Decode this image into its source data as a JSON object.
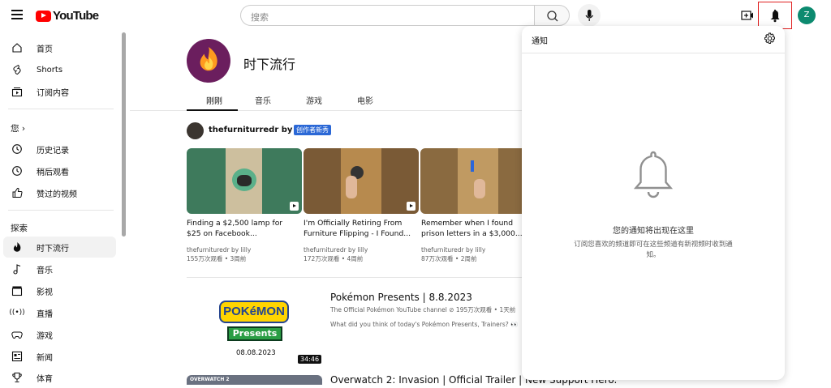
{
  "header": {
    "logo_text": "YouTube",
    "search_placeholder": "搜索",
    "avatar_letter": "Z"
  },
  "sidebar": {
    "items_top": [
      {
        "label": "首页",
        "icon": "home-icon"
      },
      {
        "label": "Shorts",
        "icon": "shorts-icon"
      },
      {
        "label": "订阅内容",
        "icon": "subscriptions-icon"
      }
    ],
    "you_heading": "您",
    "items_you": [
      {
        "label": "历史记录",
        "icon": "history-icon"
      },
      {
        "label": "稍后观看",
        "icon": "watch-later-icon"
      },
      {
        "label": "赞过的视频",
        "icon": "thumbs-up-icon"
      }
    ],
    "explore_heading": "探索",
    "items_explore": [
      {
        "label": "时下流行",
        "icon": "trending-icon"
      },
      {
        "label": "音乐",
        "icon": "music-icon"
      },
      {
        "label": "影视",
        "icon": "movies-icon"
      },
      {
        "label": "直播",
        "icon": "live-icon"
      },
      {
        "label": "游戏",
        "icon": "gaming-icon"
      },
      {
        "label": "新闻",
        "icon": "news-icon"
      },
      {
        "label": "体育",
        "icon": "sports-icon"
      }
    ]
  },
  "channel": {
    "title": "时下流行",
    "tabs": [
      "刚刚",
      "音乐",
      "游戏",
      "电影"
    ]
  },
  "shelf": {
    "channel": "thefurniturredr by lilly",
    "badge": "创作者新秀",
    "videos": [
      {
        "title": "Finding a $2,500 lamp for $25 on Facebook...",
        "channel": "thefurnituredr by lilly",
        "stats": "155万次观看 • 3周前",
        "color": "#3e7a5c"
      },
      {
        "title": "I'm Officially Retiring From Furniture Flipping - I Found...",
        "channel": "thefurnituredr by lilly",
        "stats": "172万次观看 • 4周前",
        "color": "#7a5a36"
      },
      {
        "title": "Remember when I found prison letters in a $3,000...",
        "channel": "thefurnituredr by lilly",
        "stats": "87万次观看 • 2周前",
        "color": "#8a6a40"
      }
    ]
  },
  "long_video": {
    "logo_word": "POKéMON",
    "logo_sub": "Presents",
    "date": "08.08.2023",
    "duration": "34:46",
    "title": "Pokémon Presents | 8.8.2023",
    "channel_line": "The Official Pokémon YouTube channel ⊘  195万次观看 • 1天前",
    "description": "What did you think of today's Pokémon Presents, Trainers? 👀"
  },
  "next_video": {
    "thumb_label": "OVERWATCH 2",
    "title": "Overwatch 2: Invasion | Official Trailer | New Support Hero."
  },
  "notifications": {
    "title": "通知",
    "empty_main": "您的通知将出现在这里",
    "empty_sub": "订阅您喜欢的频道即可在这些频道有新视频时收到通知。"
  }
}
